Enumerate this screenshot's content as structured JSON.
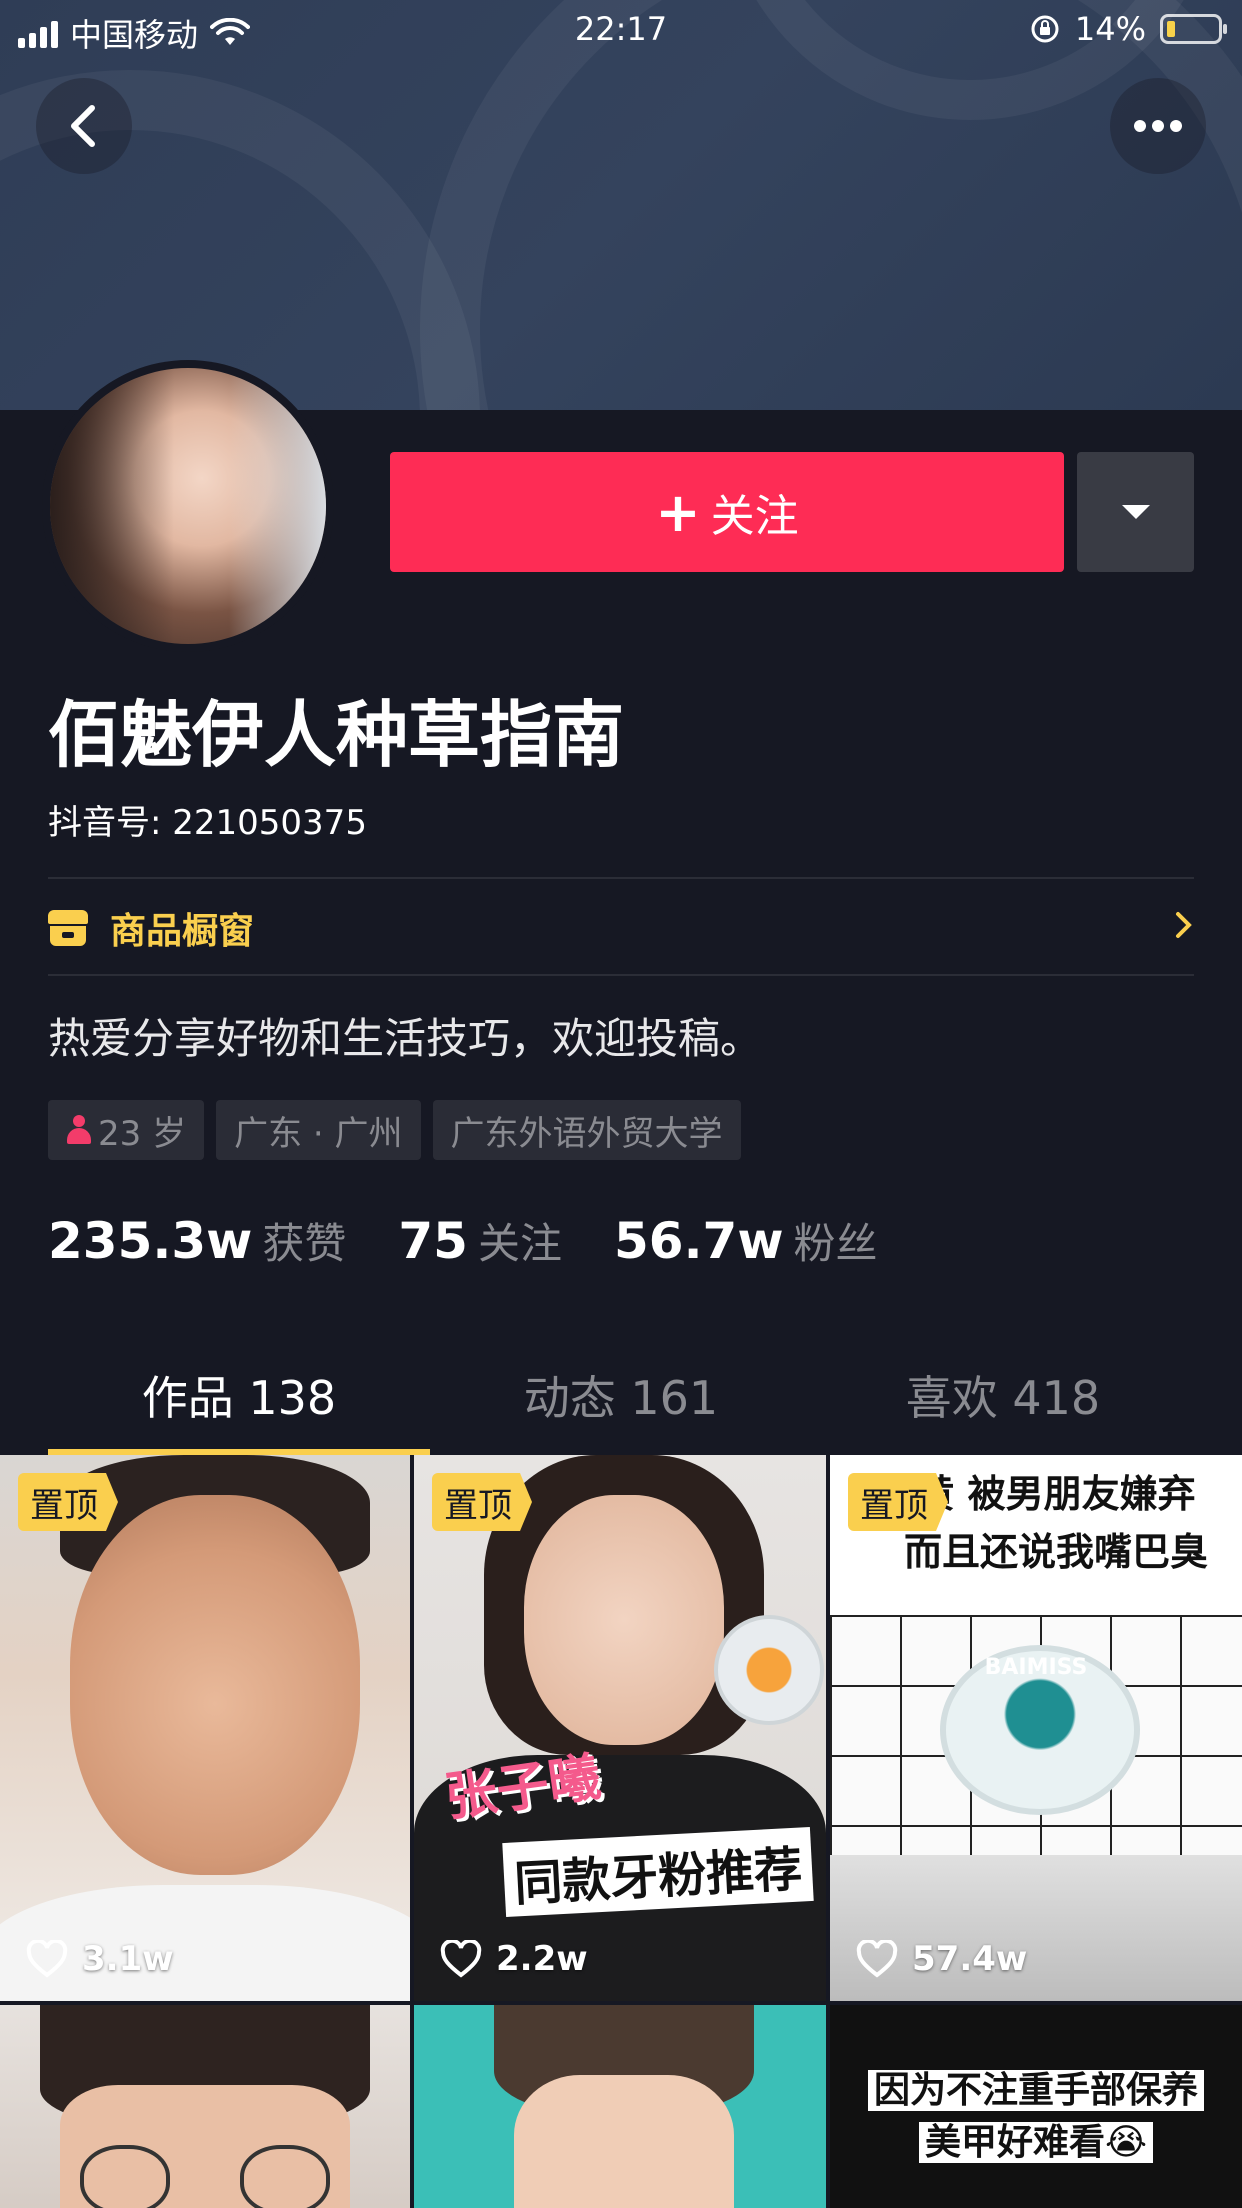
{
  "status_bar": {
    "carrier": "中国移动",
    "time": "22:17",
    "battery": "14%",
    "battery_level": 0.14,
    "icons": [
      "signal-icon",
      "wifi-icon",
      "rotation-lock-icon",
      "battery-icon"
    ]
  },
  "profile": {
    "nickname": "佰魅伊人种草指南",
    "douyin_id": "抖音号: 221050375",
    "follow_label": "关注",
    "shop_label": "商品橱窗",
    "bio": "热爱分享好物和生活技巧，欢迎投稿。",
    "tags": {
      "age": "23 岁",
      "location": "广东 · 广州",
      "school": "广东外语外贸大学"
    },
    "stats": [
      {
        "value": "235.3w",
        "label": "获赞"
      },
      {
        "value": "75",
        "label": "关注"
      },
      {
        "value": "56.7w",
        "label": "粉丝"
      }
    ]
  },
  "tabs": [
    {
      "label": "作品 138",
      "active": true
    },
    {
      "label": "动态 161",
      "active": false
    },
    {
      "label": "喜欢 418",
      "active": false
    }
  ],
  "videos": [
    {
      "pinned": "置顶",
      "likes": "3.1w"
    },
    {
      "pinned": "置顶",
      "likes": "2.2w",
      "overlay_1": "张子曦",
      "overlay_2": "同款牙粉推荐"
    },
    {
      "pinned": "置顶",
      "likes": "57.4w",
      "overlay_1": "黄 被男朋友嫌弃",
      "overlay_2": "而且还说我嘴巴臭",
      "product_label": "BAIMISS"
    },
    {},
    {},
    {
      "overlay_1": "因为不注重手部保养",
      "overlay_2": "美甲好难看😭"
    }
  ],
  "colors": {
    "background": "#161823",
    "accent_red": "#fe2c55",
    "accent_yellow": "#facf4e"
  }
}
